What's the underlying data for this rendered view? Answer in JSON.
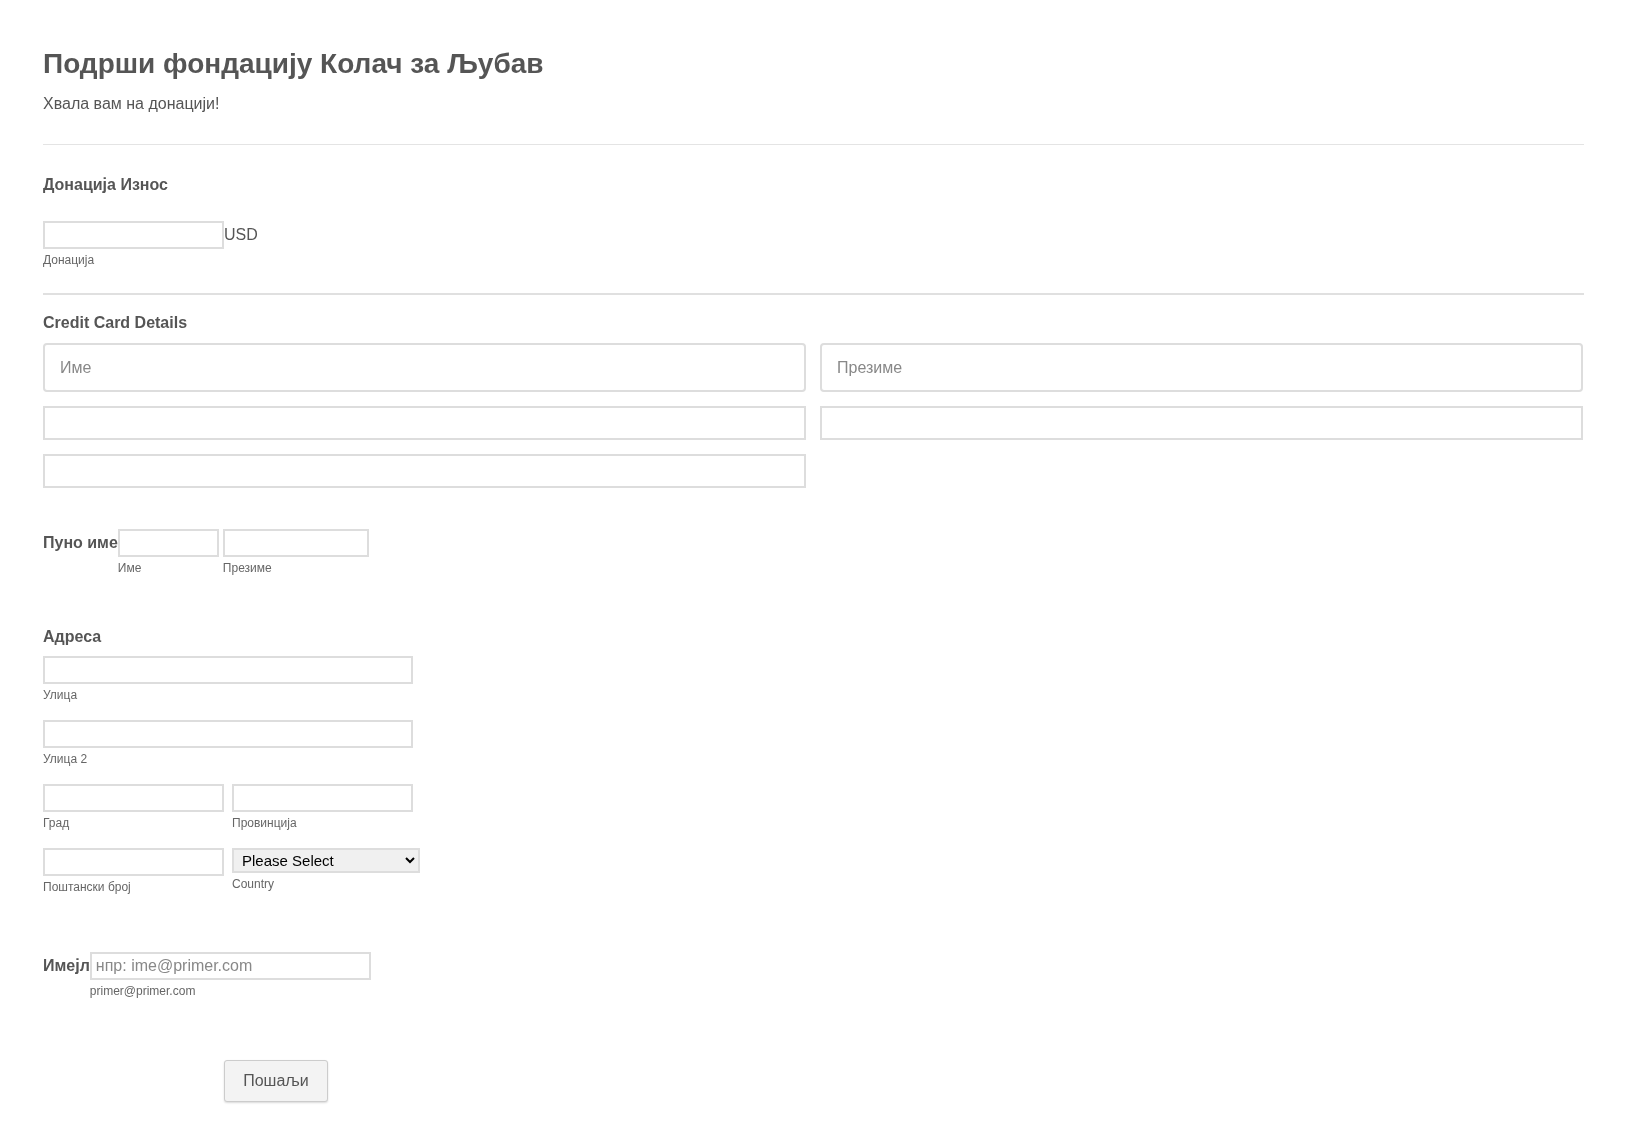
{
  "title": "Подрши фондацију Колач за Љубав",
  "subtitle": "Хвала вам на донацији!",
  "donation": {
    "label": "Донација Износ",
    "currency": "USD",
    "sublabel": "Донација"
  },
  "credit_card": {
    "label": "Credit Card Details",
    "fields": [
      {
        "kind": "name",
        "placeholder": "Име"
      },
      {
        "kind": "name",
        "placeholder": "Презиме"
      },
      {
        "kind": "line"
      },
      {
        "kind": "line"
      },
      {
        "kind": "line"
      }
    ]
  },
  "full_name": {
    "label": "Пуно име",
    "fields": [
      {
        "sublabel": "Име"
      },
      {
        "sublabel": "Презиме"
      }
    ]
  },
  "address": {
    "label": "Адреса",
    "street": "Улица",
    "street2": "Улица 2",
    "city": "Град",
    "province": "Провинција",
    "zip": "Поштански број",
    "country": {
      "value": "Please Select",
      "sublabel": "Country"
    }
  },
  "email": {
    "label": "Имејл",
    "placeholder": "нпр: ime@primer.com",
    "sublabel": "primer@primer.com"
  },
  "submit": "Пошаљи"
}
